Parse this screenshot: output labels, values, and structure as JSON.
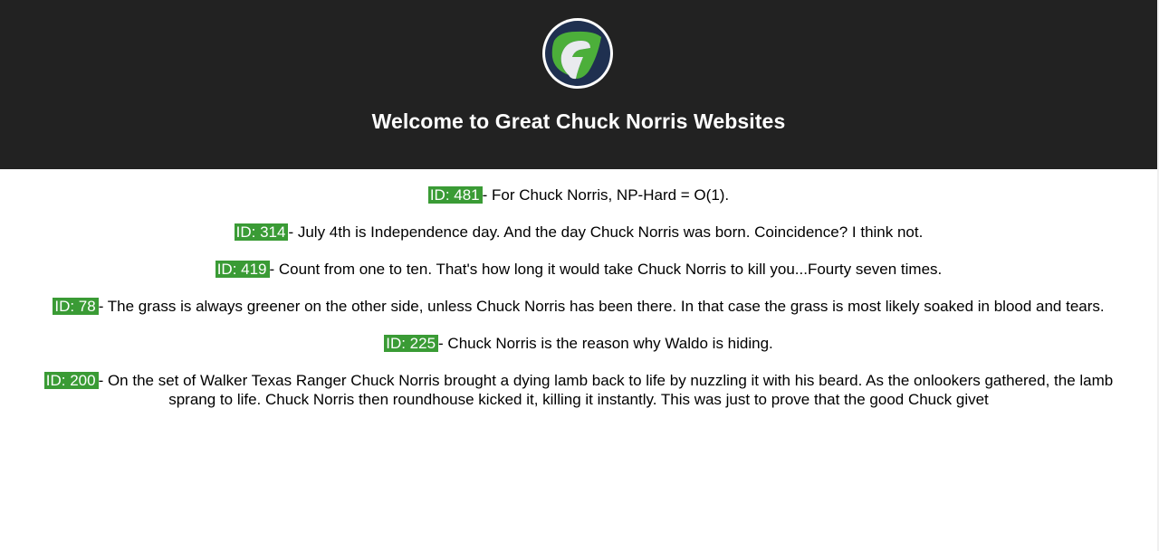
{
  "header": {
    "title": "Welcome to Great Chuck Norris Websites",
    "logo_icon": "gcn-logo-icon",
    "background": "#222222"
  },
  "colors": {
    "id_badge": "#3a9b35",
    "logo_green": "#4caf3a",
    "logo_navy": "#1f3050"
  },
  "jokes": [
    {
      "id_label": "ID: 481",
      "text": "- For Chuck Norris, NP-Hard = O(1)."
    },
    {
      "id_label": "ID: 314",
      "text": "- July 4th is Independence day. And the day Chuck Norris was born. Coincidence? I think not."
    },
    {
      "id_label": "ID: 419",
      "text": "- Count from one to ten. That's how long it would take Chuck Norris to kill you...Fourty seven times."
    },
    {
      "id_label": "ID: 78",
      "text": "- The grass is always greener on the other side, unless Chuck Norris has been there. In that case the grass is most likely soaked in blood and tears."
    },
    {
      "id_label": "ID: 225",
      "text": "- Chuck Norris is the reason why Waldo is hiding."
    },
    {
      "id_label": "ID: 200",
      "text": "- On the set of Walker Texas Ranger Chuck Norris brought a dying lamb back to life by nuzzling it with his beard. As the onlookers gathered, the lamb sprang to life. Chuck Norris then roundhouse kicked it, killing it instantly. This was just to prove that the good Chuck givet"
    }
  ]
}
